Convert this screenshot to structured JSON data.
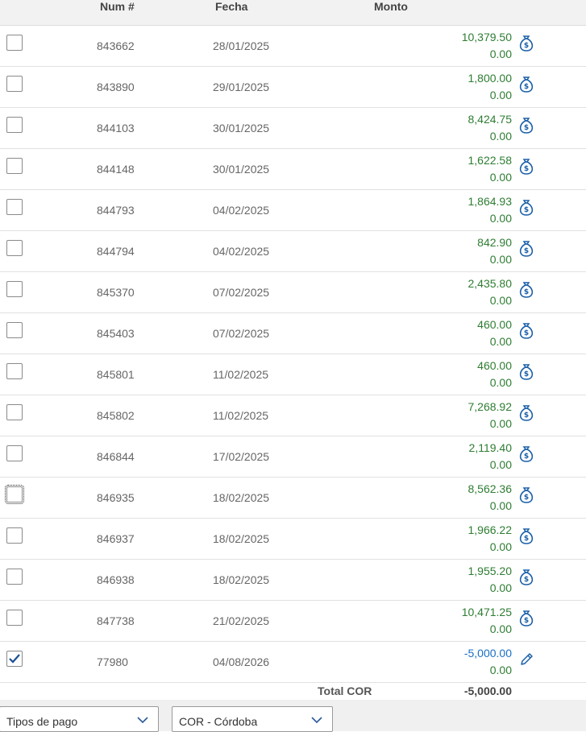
{
  "header": {
    "num_label": "Num #",
    "fecha_label": "Fecha",
    "monto_label": "Monto"
  },
  "rows": [
    {
      "checked": false,
      "num": "843662",
      "fecha": "28/01/2025",
      "monto1": "10,379.50",
      "monto2": "0.00",
      "icon": "money-bag-icon"
    },
    {
      "checked": false,
      "num": "843890",
      "fecha": "29/01/2025",
      "monto1": "1,800.00",
      "monto2": "0.00",
      "icon": "money-bag-icon"
    },
    {
      "checked": false,
      "num": "844103",
      "fecha": "30/01/2025",
      "monto1": "8,424.75",
      "monto2": "0.00",
      "icon": "money-bag-icon"
    },
    {
      "checked": false,
      "num": "844148",
      "fecha": "30/01/2025",
      "monto1": "1,622.58",
      "monto2": "0.00",
      "icon": "money-bag-icon"
    },
    {
      "checked": false,
      "num": "844793",
      "fecha": "04/02/2025",
      "monto1": "1,864.93",
      "monto2": "0.00",
      "icon": "money-bag-icon"
    },
    {
      "checked": false,
      "num": "844794",
      "fecha": "04/02/2025",
      "monto1": "842.90",
      "monto2": "0.00",
      "icon": "money-bag-icon"
    },
    {
      "checked": false,
      "num": "845370",
      "fecha": "07/02/2025",
      "monto1": "2,435.80",
      "monto2": "0.00",
      "icon": "money-bag-icon"
    },
    {
      "checked": false,
      "num": "845403",
      "fecha": "07/02/2025",
      "monto1": "460.00",
      "monto2": "0.00",
      "icon": "money-bag-icon"
    },
    {
      "checked": false,
      "num": "845801",
      "fecha": "11/02/2025",
      "monto1": "460.00",
      "monto2": "0.00",
      "icon": "money-bag-icon"
    },
    {
      "checked": false,
      "num": "845802",
      "fecha": "11/02/2025",
      "monto1": "7,268.92",
      "monto2": "0.00",
      "icon": "money-bag-icon"
    },
    {
      "checked": false,
      "num": "846844",
      "fecha": "17/02/2025",
      "monto1": "2,119.40",
      "monto2": "0.00",
      "icon": "money-bag-icon"
    },
    {
      "checked": false,
      "focused": true,
      "num": "846935",
      "fecha": "18/02/2025",
      "monto1": "8,562.36",
      "monto2": "0.00",
      "icon": "money-bag-icon"
    },
    {
      "checked": false,
      "num": "846937",
      "fecha": "18/02/2025",
      "monto1": "1,966.22",
      "monto2": "0.00",
      "icon": "money-bag-icon"
    },
    {
      "checked": false,
      "num": "846938",
      "fecha": "18/02/2025",
      "monto1": "1,955.20",
      "monto2": "0.00",
      "icon": "money-bag-icon"
    },
    {
      "checked": false,
      "num": "847738",
      "fecha": "21/02/2025",
      "monto1": "10,471.25",
      "monto2": "0.00",
      "icon": "money-bag-icon"
    },
    {
      "checked": true,
      "num": "77980",
      "fecha": "04/08/2026",
      "monto1": "-5,000.00",
      "monto2": "0.00",
      "icon": "pencil-icon"
    }
  ],
  "total": {
    "label": "Total COR",
    "value": "-5,000.00"
  },
  "footer": {
    "payment_type": "Tipos de pago",
    "currency": "COR - Córdoba"
  },
  "colors": {
    "positive": "#2e7d32",
    "negative": "#1a6fc4",
    "icon": "#1a5fa8"
  }
}
